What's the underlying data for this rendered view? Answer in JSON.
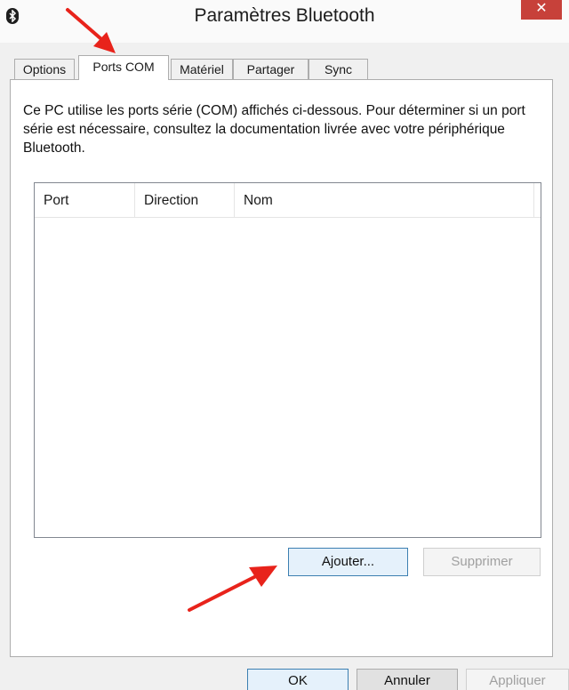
{
  "window": {
    "title": "Paramètres Bluetooth",
    "close_label": "✕"
  },
  "tabs": [
    {
      "label": "Options",
      "active": false
    },
    {
      "label": "Ports COM",
      "active": true
    },
    {
      "label": "Matériel",
      "active": false
    },
    {
      "label": "Partager",
      "active": false
    },
    {
      "label": "Sync",
      "active": false
    }
  ],
  "panel": {
    "description": "Ce PC utilise les ports série (COM) affichés ci-dessous. Pour déterminer si un port série est nécessaire, consultez la documentation livrée avec votre périphérique Bluetooth.",
    "list": {
      "columns": [
        "Port",
        "Direction",
        "Nom"
      ],
      "rows": []
    },
    "add_button": "Ajouter...",
    "remove_button": "Supprimer"
  },
  "footer": {
    "ok_button": "OK",
    "cancel_button": "Annuler",
    "apply_button": "Appliquer"
  },
  "annotation_color": "#e8231b"
}
